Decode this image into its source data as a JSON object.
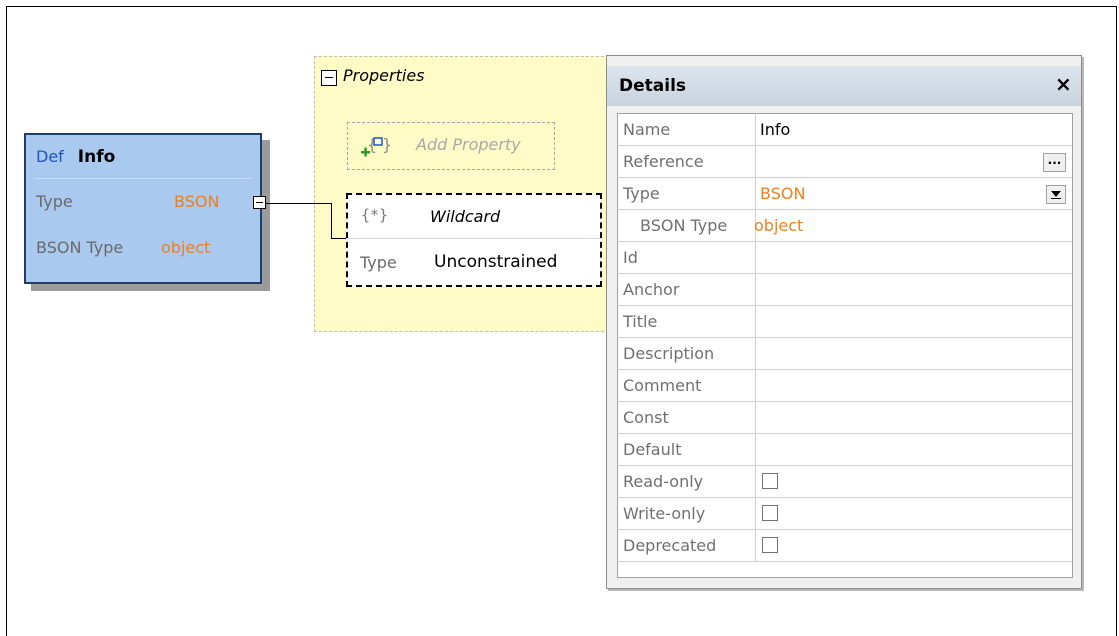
{
  "def_node": {
    "keyword": "Def",
    "name": "Info",
    "rows": [
      {
        "key": "Type",
        "value": "BSON"
      },
      {
        "key": "BSON Type",
        "value": "object"
      }
    ]
  },
  "properties": {
    "label": "Properties",
    "add_label": "Add Property",
    "wildcard": {
      "icon": "{*}",
      "name": "Wildcard",
      "type_key": "Type",
      "type_value": "Unconstrained"
    }
  },
  "details": {
    "title": "Details",
    "close": "×",
    "ellipsis": "...",
    "rows": [
      {
        "key": "Name",
        "value": "Info"
      },
      {
        "key": "Reference",
        "value": ""
      },
      {
        "key": "Type",
        "value": "BSON"
      },
      {
        "key": "BSON Type",
        "value": "object"
      },
      {
        "key": "Id",
        "value": ""
      },
      {
        "key": "Anchor",
        "value": ""
      },
      {
        "key": "Title",
        "value": ""
      },
      {
        "key": "Description",
        "value": ""
      },
      {
        "key": "Comment",
        "value": ""
      },
      {
        "key": "Const",
        "value": ""
      },
      {
        "key": "Default",
        "value": ""
      },
      {
        "key": "Read-only",
        "checked": false
      },
      {
        "key": "Write-only",
        "checked": false
      },
      {
        "key": "Deprecated",
        "checked": false
      }
    ]
  },
  "colors": {
    "node_fill": "#a9c9ee",
    "node_border": "#1f3e6e",
    "keyword_blue": "#1d55c7",
    "value_orange": "#f07f1b",
    "properties_fill": "#fefbc6"
  }
}
